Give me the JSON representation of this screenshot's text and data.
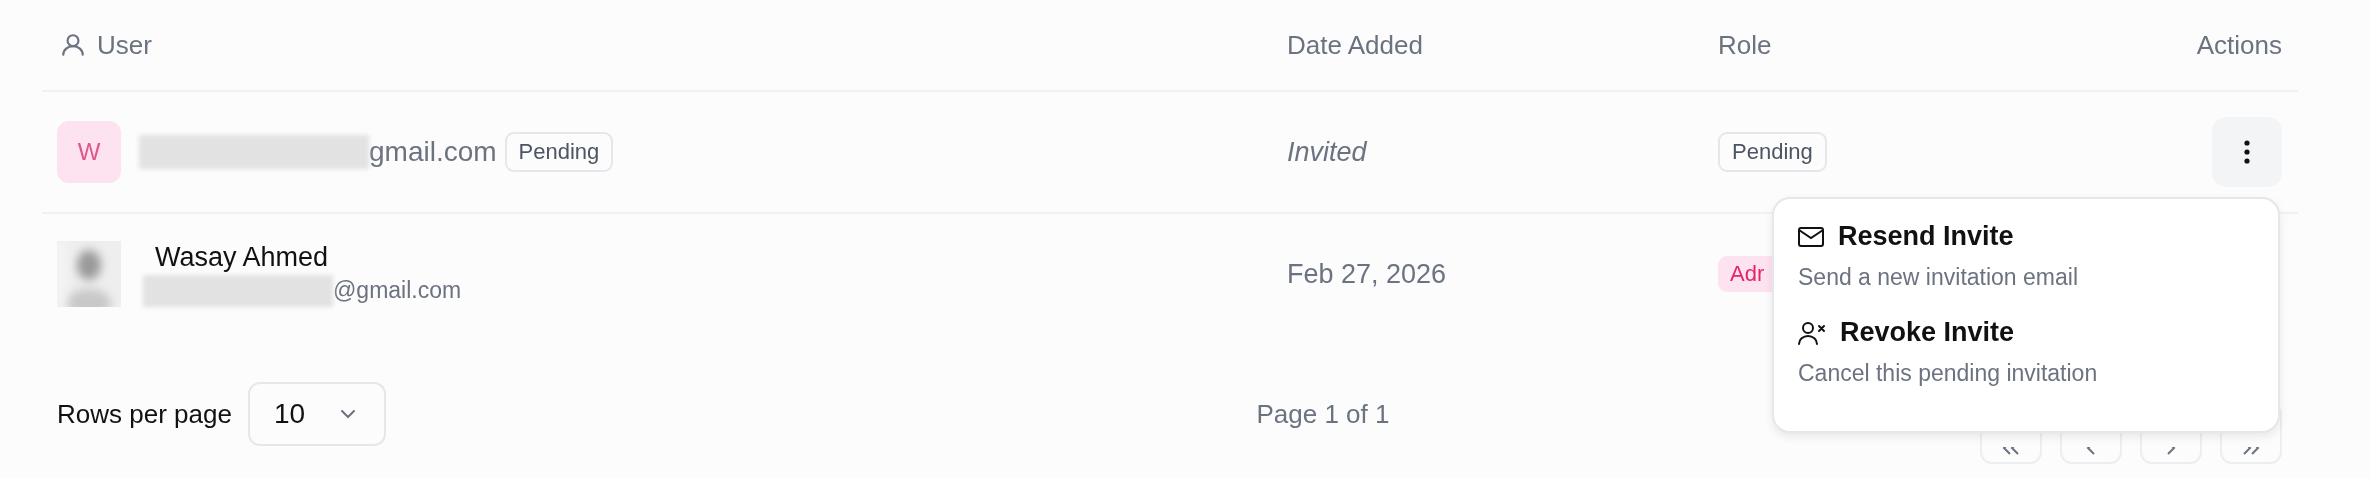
{
  "table": {
    "columns": [
      "User",
      "Date Added",
      "Role",
      "Actions"
    ],
    "rows": [
      {
        "kind": "invite",
        "avatar": "W",
        "email": "gmail.com",
        "status": "Pending",
        "date": "Invited",
        "role": "Pending"
      },
      {
        "kind": "member",
        "name": "Wasay Ahmed",
        "email": "@gmail.com",
        "date": "Feb 27, 2026",
        "role": "Adr"
      }
    ]
  },
  "menu": {
    "items": [
      {
        "kind": "mail",
        "title": "Resend Invite",
        "description": "Send a new invitation email"
      },
      {
        "kind": "user-x",
        "title": "Revoke Invite",
        "description": "Cancel this pending invitation"
      }
    ]
  },
  "footer": {
    "rows_label": "Rows per page",
    "rows_value": "10",
    "page_label": "Page 1 of 1"
  }
}
